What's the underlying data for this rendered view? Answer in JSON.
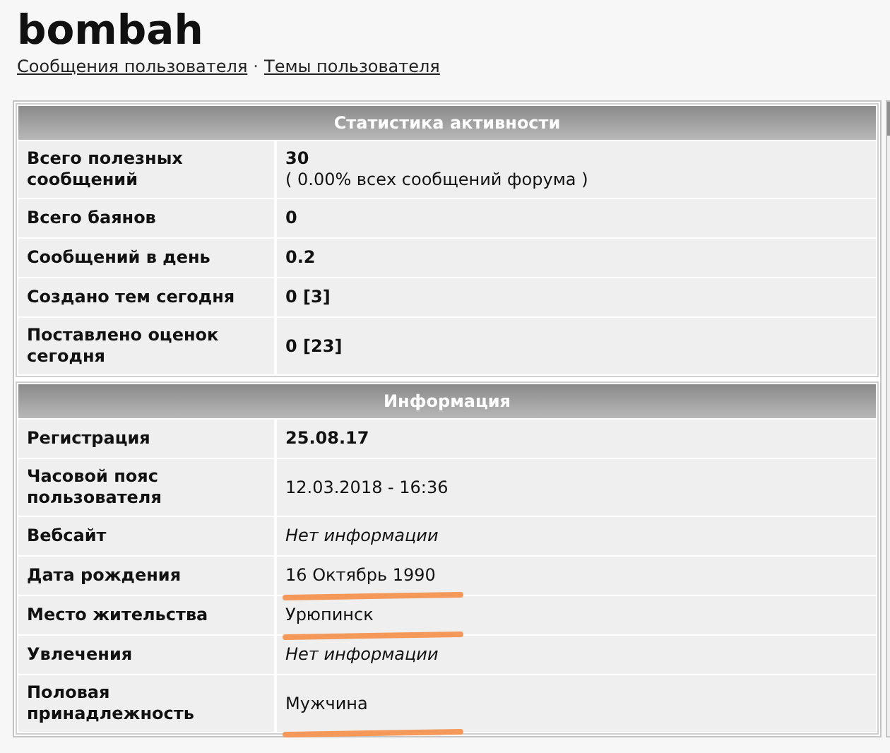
{
  "user": {
    "name": "bombah",
    "links": [
      "Сообщения пользователя",
      "Темы пользователя"
    ],
    "separator": "·"
  },
  "sections": [
    {
      "title": "Статистика активности",
      "rows": [
        {
          "label": "Всего полезных сообщений",
          "value": "30",
          "note": "( 0.00% всех сообщений форума )",
          "kind": "bold",
          "underlined": false
        },
        {
          "label": "Всего баянов",
          "value": "0",
          "kind": "bold",
          "underlined": false
        },
        {
          "label": "Сообщений в день",
          "value": "0.2",
          "kind": "bold",
          "underlined": false
        },
        {
          "label": "Создано тем сегодня",
          "value": "0 [3]",
          "kind": "bold",
          "underlined": false
        },
        {
          "label": "Поставлено оценок сегодня",
          "value": "0 [23]",
          "kind": "bold",
          "underlined": false
        }
      ]
    },
    {
      "title": "Информация",
      "rows": [
        {
          "label": "Регистрация",
          "value": "25.08.17",
          "kind": "bold",
          "underlined": false
        },
        {
          "label": "Часовой пояс пользователя",
          "value": "12.03.2018 - 16:36",
          "kind": "normal",
          "underlined": false
        },
        {
          "label": "Вебсайт",
          "value": "Нет информации",
          "kind": "italic",
          "underlined": false
        },
        {
          "label": "Дата рождения",
          "value": "16 Октябрь 1990",
          "kind": "normal",
          "underlined": true
        },
        {
          "label": "Место жительства",
          "value": "Урюпинск",
          "kind": "normal",
          "underlined": true
        },
        {
          "label": "Увлечения",
          "value": "Нет информации",
          "kind": "italic",
          "underlined": false
        },
        {
          "label": "Половая принадлежность",
          "value": "Мужчина",
          "kind": "normal",
          "underlined": true
        }
      ]
    }
  ]
}
